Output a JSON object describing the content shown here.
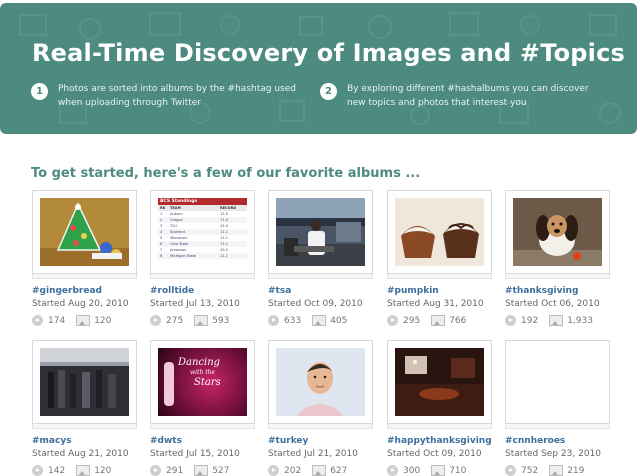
{
  "hero": {
    "title": "Real-Time Discovery of Images and #Topics",
    "steps": [
      {
        "num": "1",
        "text": "Photos are sorted into albums by the #hashtag used when uploading through Twitter"
      },
      {
        "num": "2",
        "text": "By exploring different #hashalbums you can discover new topics and photos that interest you"
      }
    ]
  },
  "section": {
    "title": "To get started, here's a few of our favorite albums ..."
  },
  "albums": [
    {
      "tag": "#gingerbread",
      "started": "Started Aug 20, 2010",
      "views": "174",
      "photos": "120"
    },
    {
      "tag": "#rolltide",
      "started": "Started Jul 13, 2010",
      "views": "275",
      "photos": "593"
    },
    {
      "tag": "#tsa",
      "started": "Started Oct 09, 2010",
      "views": "633",
      "photos": "405"
    },
    {
      "tag": "#pumpkin",
      "started": "Started Aug 31, 2010",
      "views": "295",
      "photos": "766"
    },
    {
      "tag": "#thanksgiving",
      "started": "Started Oct 06, 2010",
      "views": "192",
      "photos": "1,933"
    },
    {
      "tag": "#macys",
      "started": "Started Aug 21, 2010",
      "views": "142",
      "photos": "120"
    },
    {
      "tag": "#dwts",
      "started": "Started Jul 15, 2010",
      "views": "291",
      "photos": "527"
    },
    {
      "tag": "#turkey",
      "started": "Started Jul 21, 2010",
      "views": "202",
      "photos": "627"
    },
    {
      "tag": "#happythanksgiving",
      "started": "Started Oct 09, 2010",
      "views": "300",
      "photos": "710"
    },
    {
      "tag": "#cnnheroes",
      "started": "Started Sep 23, 2010",
      "views": "752",
      "photos": "219"
    }
  ],
  "rolltide_thumb": {
    "heading": "BCS Standings",
    "col_rank": "RK",
    "col_team": "TEAM",
    "col_record": "RECORD",
    "rows": [
      {
        "rank": "1",
        "team": "Auburn",
        "record": "12-0"
      },
      {
        "rank": "2",
        "team": "Oregon",
        "record": "11-0"
      },
      {
        "rank": "3",
        "team": "TCU",
        "record": "12-0"
      },
      {
        "rank": "4",
        "team": "Stanford",
        "record": "11-1"
      },
      {
        "rank": "5",
        "team": "Wisconsin",
        "record": "11-1"
      },
      {
        "rank": "6",
        "team": "Ohio State",
        "record": "11-1"
      },
      {
        "rank": "7",
        "team": "Arkansas",
        "record": "10-2"
      },
      {
        "rank": "8",
        "team": "Michigan State",
        "record": "11-1"
      }
    ]
  },
  "dwts_thumb": {
    "line1": "Dancing",
    "line2": "with the",
    "line3": "Stars"
  },
  "colors": {
    "hero_bg": "#4d8b80",
    "tag_link": "#3c6f9c",
    "section_title": "#4d8b80"
  }
}
